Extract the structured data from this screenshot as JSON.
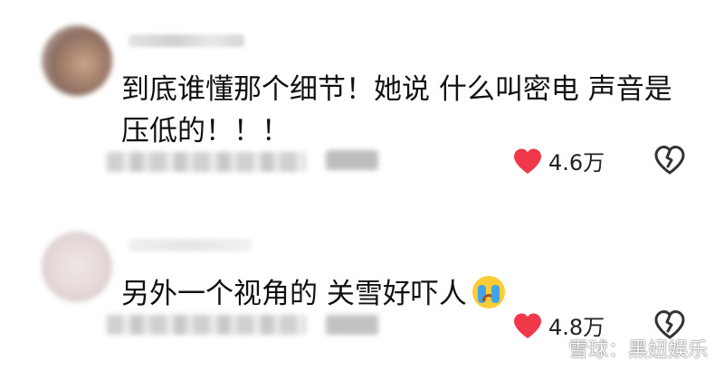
{
  "comments": [
    {
      "text": "到底谁懂那个细节！她说 什么叫密电 声音是压低的！！！",
      "like_count": "4.6万",
      "like_color": "#f0384a"
    },
    {
      "text": "另外一个视角的 关雪好吓人",
      "emoji": "loudly-crying-face",
      "like_count": "4.8万",
      "like_color": "#f0384a"
    }
  ],
  "watermark": {
    "text": "雪球：黑妞娱乐",
    "icon": "snowball-logo"
  }
}
